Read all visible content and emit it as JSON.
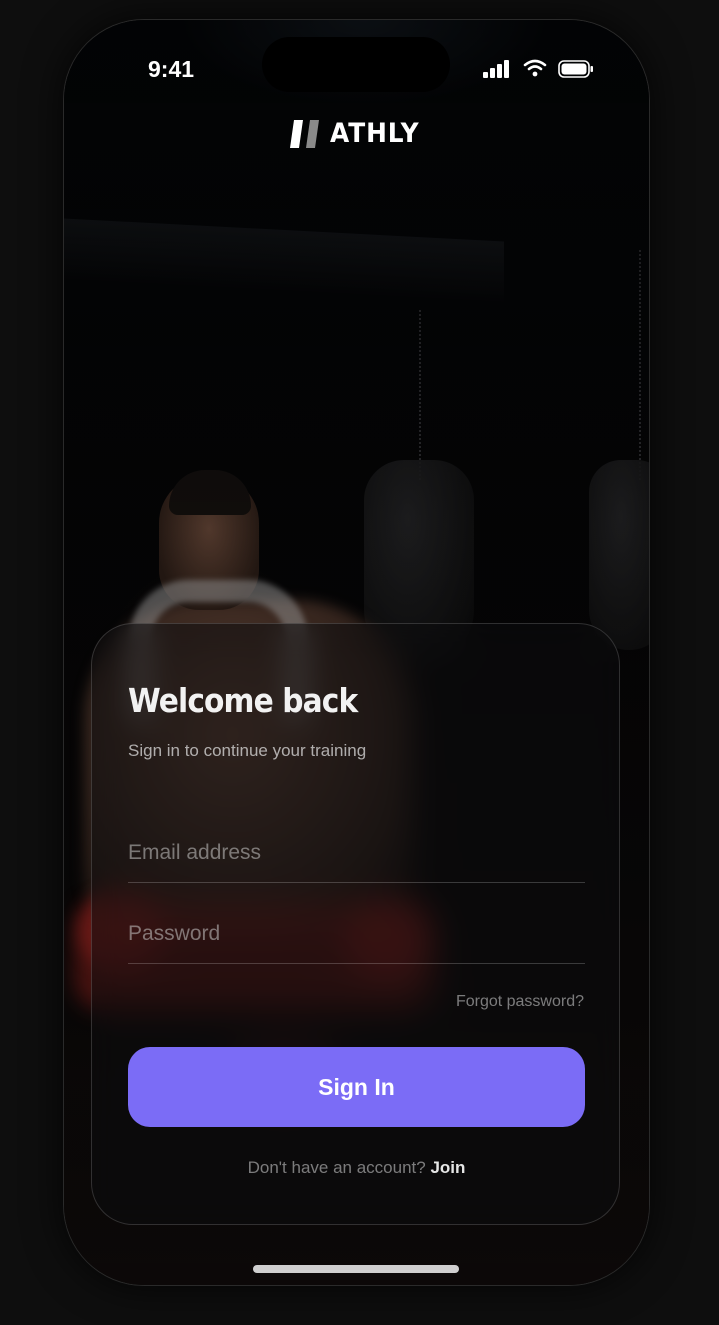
{
  "status_bar": {
    "time": "9:41"
  },
  "brand": {
    "name": "ATHLY"
  },
  "login_card": {
    "title": "Welcome back",
    "subtitle": "Sign in to continue your training",
    "email_placeholder": "Email address",
    "password_placeholder": "Password",
    "forgot_label": "Forgot password?",
    "signin_label": "Sign In",
    "signup_prompt": "Don't have an account?",
    "signup_link": "Join"
  },
  "colors": {
    "accent": "#7b6cf6",
    "background": "#0e0e0e"
  },
  "icons": {
    "signal": "cellular-signal-icon",
    "wifi": "wifi-icon",
    "battery": "battery-icon",
    "logo": "athly-logo-mark"
  }
}
